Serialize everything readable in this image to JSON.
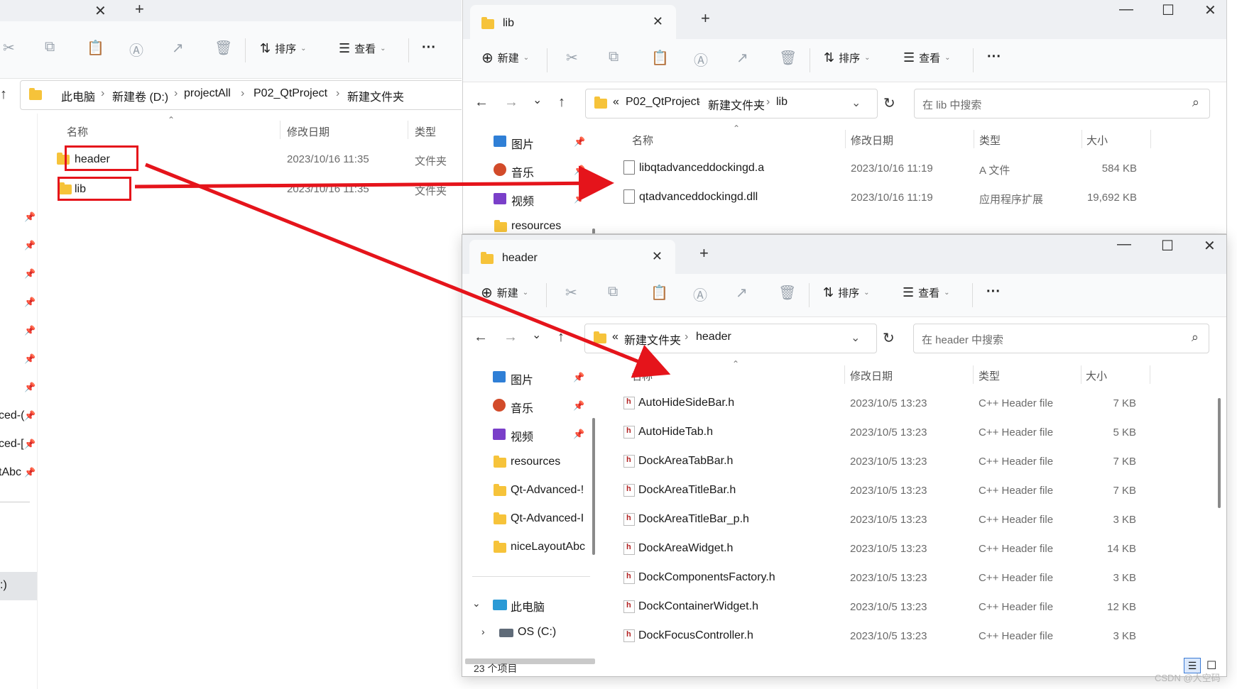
{
  "left_window": {
    "tab_close": "✕",
    "new_tab": "+",
    "toolbar": {
      "sort": "排序",
      "view": "查看",
      "more": "···"
    },
    "breadcrumb": [
      "此电脑",
      "新建卷 (D:)",
      "projectAll",
      "P02_QtProject",
      "新建文件夹"
    ],
    "columns": {
      "name": "名称",
      "date": "修改日期",
      "type": "类型"
    },
    "rows": [
      {
        "name": "header",
        "date": "2023/10/16 11:35",
        "type": "文件夹"
      },
      {
        "name": "lib",
        "date": "2023/10/16 11:35",
        "type": "文件夹"
      }
    ],
    "sidebar_partial": [
      "ced-(",
      "ced-[",
      "tAbc"
    ],
    "drive_partial": ":)"
  },
  "lib_window": {
    "tab_title": "lib",
    "toolbar": {
      "new": "新建",
      "sort": "排序",
      "view": "查看",
      "more": "···"
    },
    "breadcrumb_prefix": "«",
    "breadcrumb": [
      "P02_QtProject",
      "新建文件夹",
      "lib"
    ],
    "search_placeholder": "在 lib 中搜索",
    "sidebar": [
      {
        "label": "图片",
        "icon": "pictures-icon"
      },
      {
        "label": "音乐",
        "icon": "music-icon"
      },
      {
        "label": "视频",
        "icon": "videos-icon"
      },
      {
        "label": "resources",
        "icon": "folder-icon"
      }
    ],
    "columns": {
      "name": "名称",
      "date": "修改日期",
      "type": "类型",
      "size": "大小"
    },
    "rows": [
      {
        "name": "libqtadvanceddockingd.a",
        "date": "2023/10/16 11:19",
        "type": "A 文件",
        "size": "584 KB"
      },
      {
        "name": "qtadvanceddockingd.dll",
        "date": "2023/10/16 11:19",
        "type": "应用程序扩展",
        "size": "19,692 KB"
      }
    ]
  },
  "header_window": {
    "tab_title": "header",
    "toolbar": {
      "new": "新建",
      "sort": "排序",
      "view": "查看",
      "more": "···"
    },
    "breadcrumb_prefix": "«",
    "breadcrumb": [
      "新建文件夹",
      "header"
    ],
    "search_placeholder": "在 header 中搜索",
    "sidebar": [
      {
        "label": "图片",
        "icon": "pictures-icon",
        "pinned": true
      },
      {
        "label": "音乐",
        "icon": "music-icon",
        "pinned": true
      },
      {
        "label": "视频",
        "icon": "videos-icon",
        "pinned": true
      },
      {
        "label": "resources",
        "icon": "folder-icon",
        "pinned": false
      },
      {
        "label": "Qt-Advanced-!",
        "icon": "folder-icon",
        "pinned": false
      },
      {
        "label": "Qt-Advanced-I",
        "icon": "folder-icon",
        "pinned": false
      },
      {
        "label": "niceLayoutAbc",
        "icon": "folder-icon",
        "pinned": false
      }
    ],
    "this_pc": "此电脑",
    "os_drive": "OS (C:)",
    "columns": {
      "name": "名称",
      "date": "修改日期",
      "type": "类型",
      "size": "大小"
    },
    "rows": [
      {
        "name": "AutoHideSideBar.h",
        "date": "2023/10/5 13:23",
        "type": "C++ Header file",
        "size": "7 KB"
      },
      {
        "name": "AutoHideTab.h",
        "date": "2023/10/5 13:23",
        "type": "C++ Header file",
        "size": "5 KB"
      },
      {
        "name": "DockAreaTabBar.h",
        "date": "2023/10/5 13:23",
        "type": "C++ Header file",
        "size": "7 KB"
      },
      {
        "name": "DockAreaTitleBar.h",
        "date": "2023/10/5 13:23",
        "type": "C++ Header file",
        "size": "7 KB"
      },
      {
        "name": "DockAreaTitleBar_p.h",
        "date": "2023/10/5 13:23",
        "type": "C++ Header file",
        "size": "3 KB"
      },
      {
        "name": "DockAreaWidget.h",
        "date": "2023/10/5 13:23",
        "type": "C++ Header file",
        "size": "14 KB"
      },
      {
        "name": "DockComponentsFactory.h",
        "date": "2023/10/5 13:23",
        "type": "C++ Header file",
        "size": "3 KB"
      },
      {
        "name": "DockContainerWidget.h",
        "date": "2023/10/5 13:23",
        "type": "C++ Header file",
        "size": "12 KB"
      },
      {
        "name": "DockFocusController.h",
        "date": "2023/10/5 13:23",
        "type": "C++ Header file",
        "size": "3 KB"
      }
    ],
    "status": "23 个项目"
  },
  "watermark": "CSDN @大空码",
  "colors": {
    "annotation_red": "#e5141b",
    "folder_yellow": "#f6c33a",
    "chrome_bg": "#eef0f3"
  }
}
